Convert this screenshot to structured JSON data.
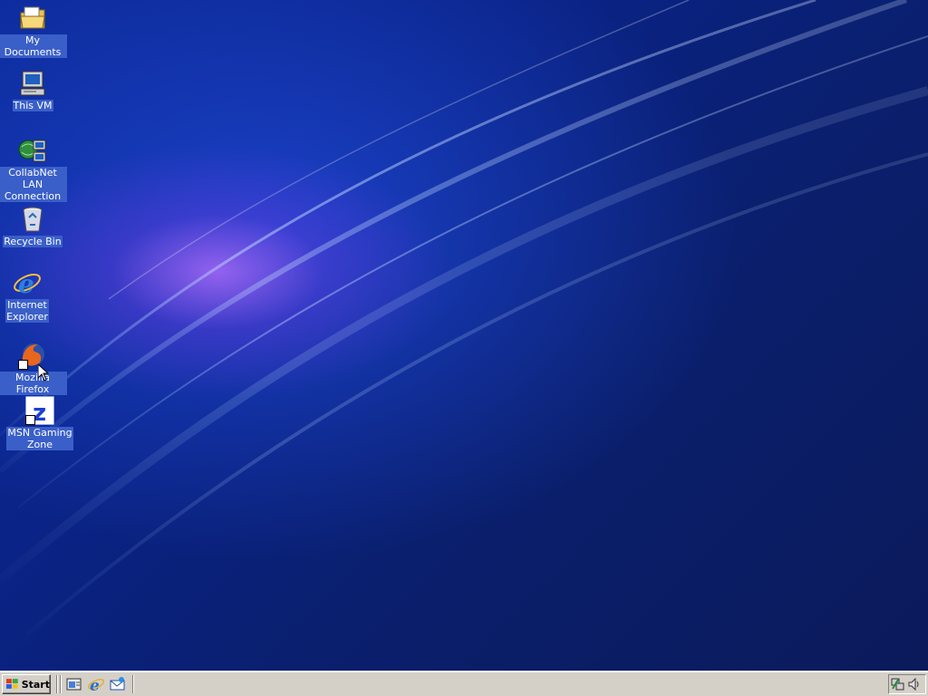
{
  "desktop": {
    "icons": [
      {
        "label": "My Documents",
        "icon": "folder-documents-icon"
      },
      {
        "label": "This VM",
        "icon": "computer-icon"
      },
      {
        "label": "CollabNet LAN\nConnection",
        "icon": "network-connection-icon"
      },
      {
        "label": "Recycle Bin",
        "icon": "recycle-bin-icon"
      },
      {
        "label": "Internet\nExplorer",
        "icon": "internet-explorer-icon"
      },
      {
        "label": "Mozilla Firefox",
        "icon": "firefox-icon"
      },
      {
        "label": "MSN Gaming\nZone",
        "icon": "msn-gaming-zone-icon"
      }
    ]
  },
  "taskbar": {
    "start_label": "Start",
    "quick_launch": [
      "show-desktop-icon",
      "internet-explorer-icon",
      "outlook-express-icon"
    ],
    "tray": [
      "network-tray-icon",
      "volume-icon"
    ]
  },
  "colors": {
    "desktop_bg": "#0a1f6b",
    "label_highlight": "#3a5fc8",
    "taskbar": "#d4d0c8"
  }
}
